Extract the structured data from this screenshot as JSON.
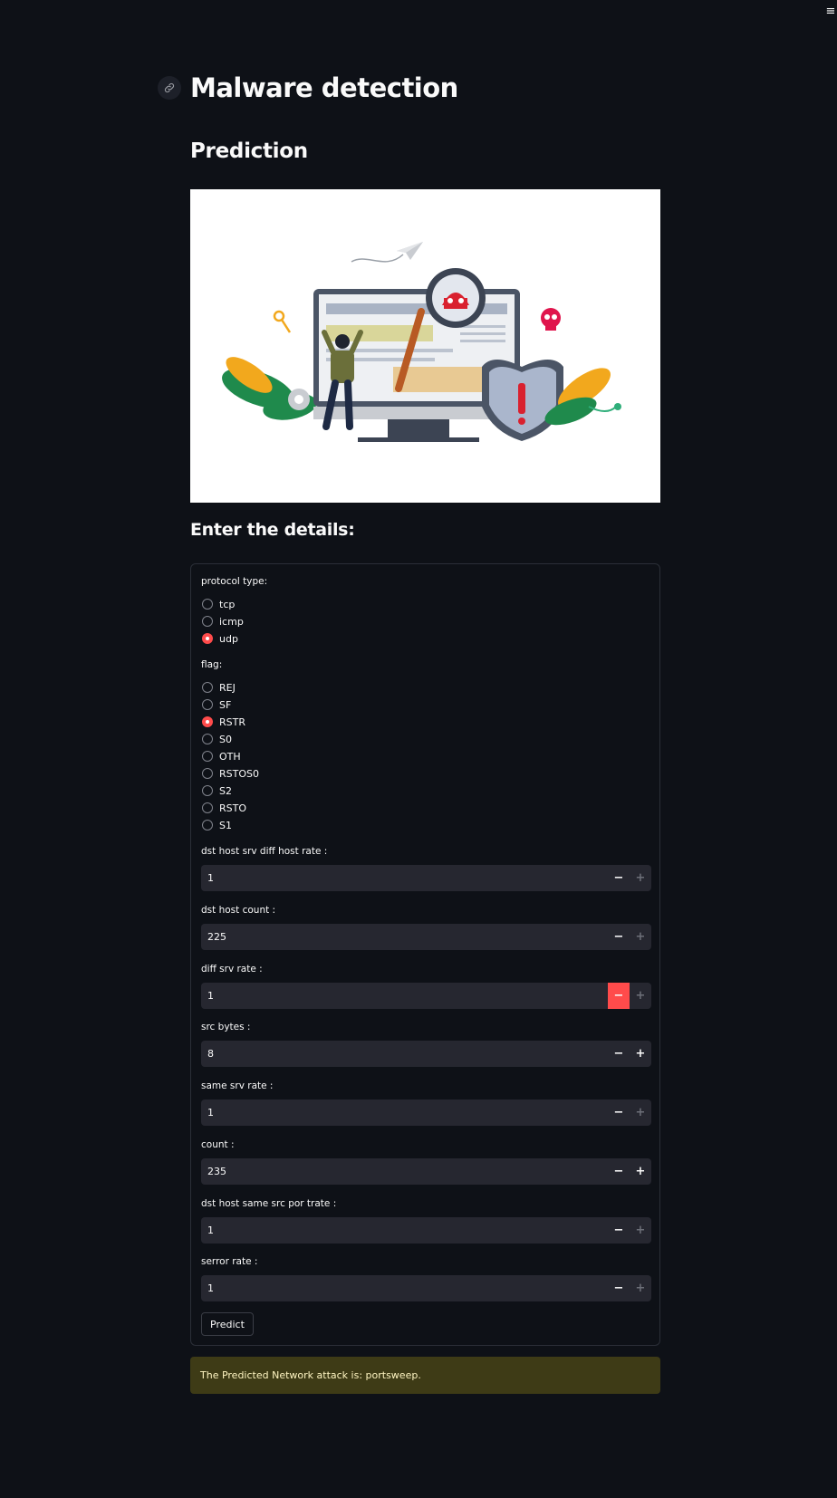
{
  "app": {
    "title": "Malware detection",
    "subtitle": "Prediction",
    "section_heading": "Enter the details:"
  },
  "form": {
    "protocol": {
      "label": "protocol type:",
      "options": [
        "tcp",
        "icmp",
        "udp"
      ],
      "selected": "udp"
    },
    "flag": {
      "label": "flag:",
      "options": [
        "REJ",
        "SF",
        "RSTR",
        "S0",
        "OTH",
        "RSTOS0",
        "S2",
        "RSTO",
        "S1"
      ],
      "selected": "RSTR"
    },
    "fields": [
      {
        "label": "dst host srv diff host rate :",
        "value": "1"
      },
      {
        "label": "dst host count :",
        "value": "225"
      },
      {
        "label": "diff srv rate :",
        "value": "1"
      },
      {
        "label": "src bytes :",
        "value": "8"
      },
      {
        "label": "same srv rate :",
        "value": "1"
      },
      {
        "label": "count :",
        "value": "235"
      },
      {
        "label": "dst host same src por trate :",
        "value": "1"
      },
      {
        "label": "serror rate :",
        "value": "1"
      }
    ],
    "minus_symbol": "−",
    "plus_symbol": "+",
    "predict_label": "Predict"
  },
  "result": {
    "text": "The Predicted Network attack is: portsweep."
  },
  "colors": {
    "background": "#0e1117",
    "accent": "#ff4b4b",
    "input_bg": "#262730",
    "result_bg": "#3e3b16"
  },
  "icons": {
    "menu": "hamburger-menu-icon",
    "anchor": "link-icon"
  }
}
